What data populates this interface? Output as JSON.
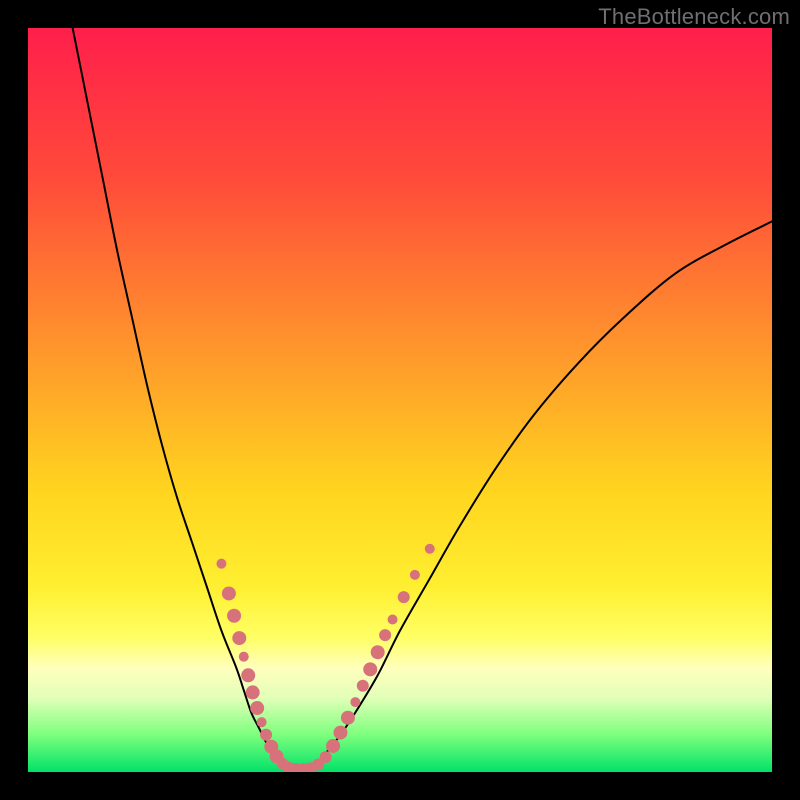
{
  "watermark": "TheBottleneck.com",
  "chart_data": {
    "type": "line",
    "title": "",
    "xlabel": "",
    "ylabel": "",
    "xlim": [
      0,
      100
    ],
    "ylim": [
      0,
      100
    ],
    "gradient_stops": [
      {
        "pct": 0,
        "color": "#ff1f4b"
      },
      {
        "pct": 20,
        "color": "#ff4a3a"
      },
      {
        "pct": 45,
        "color": "#ff9c2b"
      },
      {
        "pct": 62,
        "color": "#ffd41f"
      },
      {
        "pct": 75,
        "color": "#ffef30"
      },
      {
        "pct": 82,
        "color": "#ffff66"
      },
      {
        "pct": 86,
        "color": "#ffffbc"
      },
      {
        "pct": 90,
        "color": "#e2ffb8"
      },
      {
        "pct": 95,
        "color": "#7dff7d"
      },
      {
        "pct": 100,
        "color": "#00e268"
      }
    ],
    "series": [
      {
        "name": "bottleneck-left",
        "stroke": "#000000",
        "stroke_width": 2,
        "x": [
          6,
          8,
          10,
          12,
          14,
          16,
          18,
          20,
          22,
          24,
          26,
          28,
          29,
          30,
          31,
          32,
          33,
          34,
          35
        ],
        "y": [
          100,
          90,
          80,
          70,
          61,
          52,
          44,
          37,
          31,
          25,
          19,
          14,
          11,
          8,
          6,
          4,
          2.5,
          1.2,
          0.5
        ]
      },
      {
        "name": "bottleneck-right",
        "stroke": "#000000",
        "stroke_width": 2,
        "x": [
          38,
          39,
          40,
          42,
          44,
          47,
          50,
          54,
          58,
          63,
          68,
          74,
          80,
          87,
          94,
          100
        ],
        "y": [
          0.5,
          1.2,
          2.5,
          5,
          8,
          13,
          19,
          26,
          33,
          41,
          48,
          55,
          61,
          67,
          71,
          74
        ]
      }
    ],
    "marker_clusters": [
      {
        "name": "left-cluster",
        "color": "#d7727b",
        "points": [
          {
            "x": 26.0,
            "y": 28.0,
            "r": 5
          },
          {
            "x": 27.0,
            "y": 24.0,
            "r": 7
          },
          {
            "x": 27.7,
            "y": 21.0,
            "r": 7
          },
          {
            "x": 28.4,
            "y": 18.0,
            "r": 7
          },
          {
            "x": 29.0,
            "y": 15.5,
            "r": 5
          },
          {
            "x": 29.6,
            "y": 13.0,
            "r": 7
          },
          {
            "x": 30.2,
            "y": 10.7,
            "r": 7
          },
          {
            "x": 30.8,
            "y": 8.6,
            "r": 7
          },
          {
            "x": 31.4,
            "y": 6.7,
            "r": 5
          },
          {
            "x": 32.0,
            "y": 5.0,
            "r": 6
          },
          {
            "x": 32.7,
            "y": 3.4,
            "r": 7
          },
          {
            "x": 33.4,
            "y": 2.1,
            "r": 7
          },
          {
            "x": 34.2,
            "y": 1.1,
            "r": 6
          },
          {
            "x": 35.0,
            "y": 0.6,
            "r": 6
          },
          {
            "x": 36.0,
            "y": 0.4,
            "r": 6
          },
          {
            "x": 37.0,
            "y": 0.4,
            "r": 6
          },
          {
            "x": 38.0,
            "y": 0.5,
            "r": 6
          }
        ]
      },
      {
        "name": "right-cluster",
        "color": "#d7727b",
        "points": [
          {
            "x": 39.0,
            "y": 1.0,
            "r": 6
          },
          {
            "x": 40.0,
            "y": 2.0,
            "r": 6
          },
          {
            "x": 41.0,
            "y": 3.5,
            "r": 7
          },
          {
            "x": 42.0,
            "y": 5.3,
            "r": 7
          },
          {
            "x": 43.0,
            "y": 7.3,
            "r": 7
          },
          {
            "x": 44.0,
            "y": 9.4,
            "r": 5
          },
          {
            "x": 45.0,
            "y": 11.6,
            "r": 6
          },
          {
            "x": 46.0,
            "y": 13.8,
            "r": 7
          },
          {
            "x": 47.0,
            "y": 16.1,
            "r": 7
          },
          {
            "x": 48.0,
            "y": 18.4,
            "r": 6
          },
          {
            "x": 49.0,
            "y": 20.5,
            "r": 5
          },
          {
            "x": 50.5,
            "y": 23.5,
            "r": 6
          },
          {
            "x": 52.0,
            "y": 26.5,
            "r": 5
          },
          {
            "x": 54.0,
            "y": 30.0,
            "r": 5
          }
        ]
      }
    ]
  }
}
